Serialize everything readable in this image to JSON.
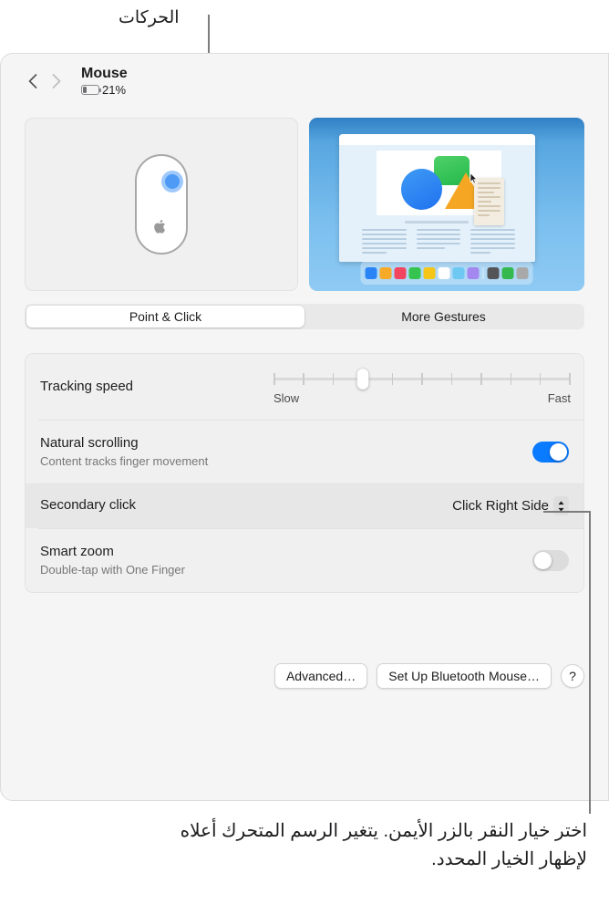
{
  "annotations": {
    "top_label": "الحركات",
    "bottom_caption": "اختر خيار النقر بالزر الأيمن. يتغير الرسم المتحرك أعلاه لإظهار الخيار المحدد."
  },
  "toolbar": {
    "back_icon": "chevron-left-icon",
    "forward_icon": "chevron-right-icon",
    "title": "Mouse",
    "battery_percent": "21%",
    "battery_level": 21
  },
  "illustration": {
    "mouse_alt": "magic-mouse-right-side-highlight",
    "desktop_alt": "desktop-preview",
    "dock_colors": [
      "#2b84f5",
      "#f7a928",
      "#f2455f",
      "#35c44f",
      "#f5c518",
      "#ffffff",
      "#6ec8f2",
      "#a587f0",
      "#555558",
      "#35b94f",
      "#a9a9a9"
    ]
  },
  "tabs": [
    {
      "label": "Point & Click",
      "selected": true
    },
    {
      "label": "More Gestures",
      "selected": false
    }
  ],
  "settings": {
    "tracking_speed": {
      "label": "Tracking speed",
      "slow_label": "Slow",
      "fast_label": "Fast",
      "ticks": 11,
      "value_index": 3
    },
    "natural_scrolling": {
      "label": "Natural scrolling",
      "sublabel": "Content tracks finger movement",
      "state": "on"
    },
    "secondary_click": {
      "label": "Secondary click",
      "value": "Click Right Side",
      "highlighted": true
    },
    "smart_zoom": {
      "label": "Smart zoom",
      "sublabel": "Double-tap with One Finger",
      "state": "off"
    }
  },
  "buttons": {
    "advanced": "Advanced…",
    "setup_bluetooth": "Set Up Bluetooth Mouse…",
    "help": "?"
  },
  "colors": {
    "accent_blue": "#0a7aff",
    "panel_bg": "#f5f5f5",
    "group_bg": "#f0f0f0",
    "row_highlight": "#e7e7e7",
    "callout_line": "#7c7c7c"
  }
}
